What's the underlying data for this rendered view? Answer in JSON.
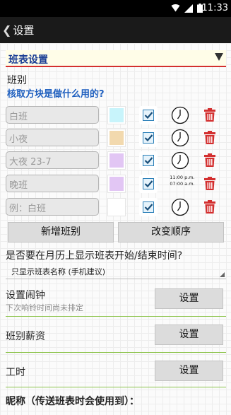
{
  "status_bar": {
    "time": "11:33",
    "icons": [
      "wifi-icon",
      "signal-icon",
      "battery-icon"
    ]
  },
  "app_bar": {
    "back_glyph": "❮",
    "title": "设置"
  },
  "schedule_selector": {
    "selected": "班表设置"
  },
  "shifts_section": {
    "heading": "班别",
    "help_link": "核取方块是做什么用的?",
    "rows": [
      {
        "name_placeholder": "白班",
        "color": "#c8f4fb",
        "checked": true,
        "time_text_1": "",
        "time_text_2": ""
      },
      {
        "name_placeholder": "小夜",
        "color": "#f2d9ae",
        "checked": true,
        "time_text_1": "",
        "time_text_2": ""
      },
      {
        "name_placeholder": "大夜 23-7",
        "color": "#e2c6f4",
        "checked": true,
        "time_text_1": "",
        "time_text_2": ""
      },
      {
        "name_placeholder": "晚班",
        "color": "#e2c6f4",
        "checked": true,
        "time_text_1": "11:00 p.m.",
        "time_text_2": "07:00 a.m."
      },
      {
        "name_placeholder": "例：白班",
        "color": "#ffffff",
        "checked": true,
        "time_text_1": "",
        "time_text_2": ""
      }
    ]
  },
  "shift_buttons": {
    "add_label": "新增班别",
    "reorder_label": "改变顺序"
  },
  "calendar_display": {
    "question": "是否要在月历上显示班表开始/结束时间?",
    "selected_option": "只显示班表名称 (手机建议)"
  },
  "alarm": {
    "title": "设置闹钟",
    "subtitle": "下次响铃时间尚未排定",
    "button_label": "设置"
  },
  "salary": {
    "title": "班别薪资",
    "button_label": "设置"
  },
  "work_hours": {
    "title": "工时",
    "button_label": "设置"
  },
  "nickname": {
    "label": "昵称（传送班表时会使用到）："
  },
  "colors": {
    "accent_red": "#d32f2f",
    "link_blue": "#1e5fbf",
    "divider_green": "#8bc34a"
  }
}
